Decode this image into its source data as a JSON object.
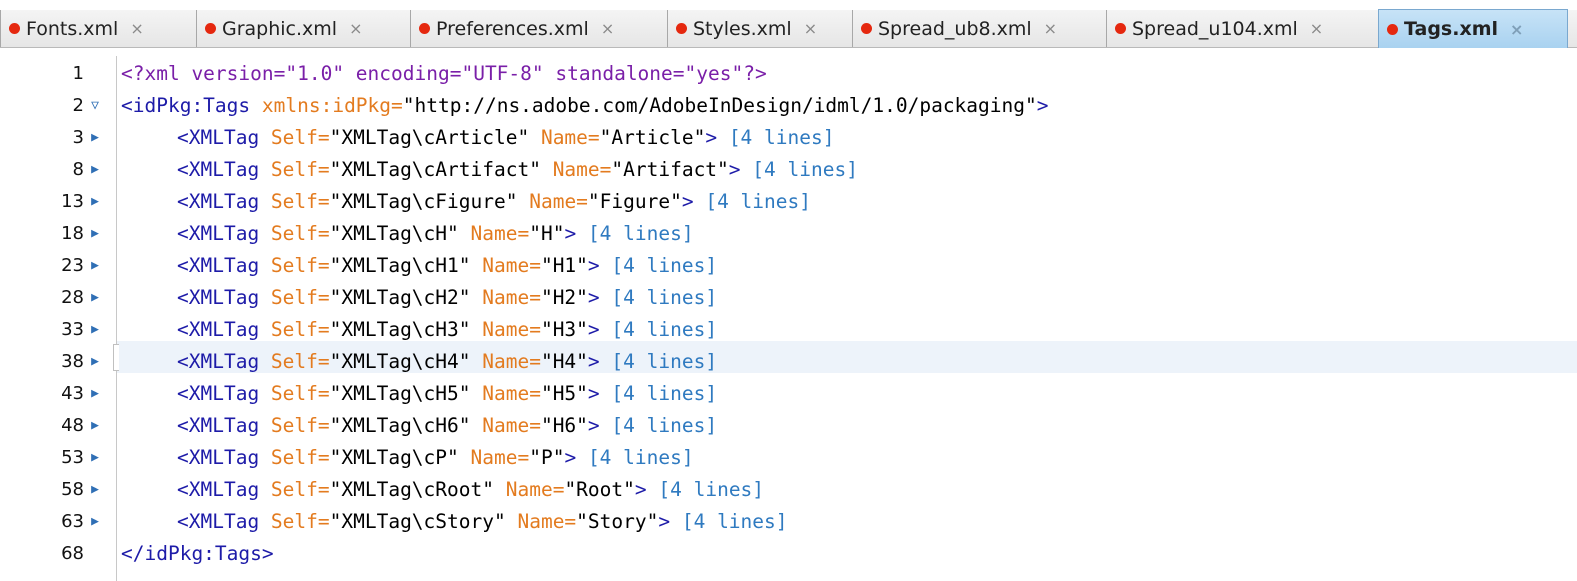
{
  "tabs": [
    {
      "label": "Fonts.xml",
      "close": "×",
      "active": false
    },
    {
      "label": "Graphic.xml",
      "close": "×",
      "active": false
    },
    {
      "label": "Preferences.xml",
      "close": "×",
      "active": false
    },
    {
      "label": "Styles.xml",
      "close": "×",
      "active": false
    },
    {
      "label": "Spread_ub8.xml",
      "close": "×",
      "active": false
    },
    {
      "label": "Spread_u104.xml",
      "close": "×",
      "active": false
    },
    {
      "label": "Tags.xml",
      "close": "×",
      "active": true
    }
  ],
  "editor": {
    "current_line": "38",
    "lines": [
      {
        "num": "1",
        "fold": "",
        "indent": false,
        "tokens": [
          {
            "c": "pi",
            "t": "<?xml version=\"1.0\" encoding=\"UTF-8\" standalone=\"yes\"?>"
          }
        ]
      },
      {
        "num": "2",
        "fold": "▽",
        "indent": false,
        "tokens": [
          {
            "c": "tag",
            "t": "<idPkg:Tags "
          },
          {
            "c": "attr",
            "t": "xmlns:idPkg="
          },
          {
            "c": "val",
            "t": "\"http://ns.adobe.com/AdobeInDesign/idml/1.0/packaging\""
          },
          {
            "c": "tag",
            "t": ">"
          }
        ]
      },
      {
        "num": "3",
        "fold": "▶",
        "indent": true,
        "tokens": [
          {
            "c": "tag",
            "t": "<XMLTag "
          },
          {
            "c": "attr",
            "t": "Self="
          },
          {
            "c": "val",
            "t": "\"XMLTag\\cArticle\" "
          },
          {
            "c": "attr",
            "t": "Name="
          },
          {
            "c": "val",
            "t": "\"Article\""
          },
          {
            "c": "tag",
            "t": "> "
          },
          {
            "c": "collapsed",
            "t": "[4 lines]"
          }
        ]
      },
      {
        "num": "8",
        "fold": "▶",
        "indent": true,
        "tokens": [
          {
            "c": "tag",
            "t": "<XMLTag "
          },
          {
            "c": "attr",
            "t": "Self="
          },
          {
            "c": "val",
            "t": "\"XMLTag\\cArtifact\" "
          },
          {
            "c": "attr",
            "t": "Name="
          },
          {
            "c": "val",
            "t": "\"Artifact\""
          },
          {
            "c": "tag",
            "t": "> "
          },
          {
            "c": "collapsed",
            "t": "[4 lines]"
          }
        ]
      },
      {
        "num": "13",
        "fold": "▶",
        "indent": true,
        "tokens": [
          {
            "c": "tag",
            "t": "<XMLTag "
          },
          {
            "c": "attr",
            "t": "Self="
          },
          {
            "c": "val",
            "t": "\"XMLTag\\cFigure\" "
          },
          {
            "c": "attr",
            "t": "Name="
          },
          {
            "c": "val",
            "t": "\"Figure\""
          },
          {
            "c": "tag",
            "t": "> "
          },
          {
            "c": "collapsed",
            "t": "[4 lines]"
          }
        ]
      },
      {
        "num": "18",
        "fold": "▶",
        "indent": true,
        "tokens": [
          {
            "c": "tag",
            "t": "<XMLTag "
          },
          {
            "c": "attr",
            "t": "Self="
          },
          {
            "c": "val",
            "t": "\"XMLTag\\cH\" "
          },
          {
            "c": "attr",
            "t": "Name="
          },
          {
            "c": "val",
            "t": "\"H\""
          },
          {
            "c": "tag",
            "t": "> "
          },
          {
            "c": "collapsed",
            "t": "[4 lines]"
          }
        ]
      },
      {
        "num": "23",
        "fold": "▶",
        "indent": true,
        "tokens": [
          {
            "c": "tag",
            "t": "<XMLTag "
          },
          {
            "c": "attr",
            "t": "Self="
          },
          {
            "c": "val",
            "t": "\"XMLTag\\cH1\" "
          },
          {
            "c": "attr",
            "t": "Name="
          },
          {
            "c": "val",
            "t": "\"H1\""
          },
          {
            "c": "tag",
            "t": "> "
          },
          {
            "c": "collapsed",
            "t": "[4 lines]"
          }
        ]
      },
      {
        "num": "28",
        "fold": "▶",
        "indent": true,
        "tokens": [
          {
            "c": "tag",
            "t": "<XMLTag "
          },
          {
            "c": "attr",
            "t": "Self="
          },
          {
            "c": "val",
            "t": "\"XMLTag\\cH2\" "
          },
          {
            "c": "attr",
            "t": "Name="
          },
          {
            "c": "val",
            "t": "\"H2\""
          },
          {
            "c": "tag",
            "t": "> "
          },
          {
            "c": "collapsed",
            "t": "[4 lines]"
          }
        ]
      },
      {
        "num": "33",
        "fold": "▶",
        "indent": true,
        "tokens": [
          {
            "c": "tag",
            "t": "<XMLTag "
          },
          {
            "c": "attr",
            "t": "Self="
          },
          {
            "c": "val",
            "t": "\"XMLTag\\cH3\" "
          },
          {
            "c": "attr",
            "t": "Name="
          },
          {
            "c": "val",
            "t": "\"H3\""
          },
          {
            "c": "tag",
            "t": "> "
          },
          {
            "c": "collapsed",
            "t": "[4 lines]"
          }
        ]
      },
      {
        "num": "38",
        "fold": "▶",
        "indent": true,
        "tokens": [
          {
            "c": "tag",
            "t": "<XMLTag "
          },
          {
            "c": "attr",
            "t": "Self="
          },
          {
            "c": "val",
            "t": "\"XMLTag\\cH4\" "
          },
          {
            "c": "attr",
            "t": "Name="
          },
          {
            "c": "val",
            "t": "\"H4\""
          },
          {
            "c": "tag",
            "t": "> "
          },
          {
            "c": "collapsed",
            "t": "[4 lines]"
          }
        ]
      },
      {
        "num": "43",
        "fold": "▶",
        "indent": true,
        "tokens": [
          {
            "c": "tag",
            "t": "<XMLTag "
          },
          {
            "c": "attr",
            "t": "Self="
          },
          {
            "c": "val",
            "t": "\"XMLTag\\cH5\" "
          },
          {
            "c": "attr",
            "t": "Name="
          },
          {
            "c": "val",
            "t": "\"H5\""
          },
          {
            "c": "tag",
            "t": "> "
          },
          {
            "c": "collapsed",
            "t": "[4 lines]"
          }
        ]
      },
      {
        "num": "48",
        "fold": "▶",
        "indent": true,
        "tokens": [
          {
            "c": "tag",
            "t": "<XMLTag "
          },
          {
            "c": "attr",
            "t": "Self="
          },
          {
            "c": "val",
            "t": "\"XMLTag\\cH6\" "
          },
          {
            "c": "attr",
            "t": "Name="
          },
          {
            "c": "val",
            "t": "\"H6\""
          },
          {
            "c": "tag",
            "t": "> "
          },
          {
            "c": "collapsed",
            "t": "[4 lines]"
          }
        ]
      },
      {
        "num": "53",
        "fold": "▶",
        "indent": true,
        "tokens": [
          {
            "c": "tag",
            "t": "<XMLTag "
          },
          {
            "c": "attr",
            "t": "Self="
          },
          {
            "c": "val",
            "t": "\"XMLTag\\cP\" "
          },
          {
            "c": "attr",
            "t": "Name="
          },
          {
            "c": "val",
            "t": "\"P\""
          },
          {
            "c": "tag",
            "t": "> "
          },
          {
            "c": "collapsed",
            "t": "[4 lines]"
          }
        ]
      },
      {
        "num": "58",
        "fold": "▶",
        "indent": true,
        "tokens": [
          {
            "c": "tag",
            "t": "<XMLTag "
          },
          {
            "c": "attr",
            "t": "Self="
          },
          {
            "c": "val",
            "t": "\"XMLTag\\cRoot\" "
          },
          {
            "c": "attr",
            "t": "Name="
          },
          {
            "c": "val",
            "t": "\"Root\""
          },
          {
            "c": "tag",
            "t": "> "
          },
          {
            "c": "collapsed",
            "t": "[4 lines]"
          }
        ]
      },
      {
        "num": "63",
        "fold": "▶",
        "indent": true,
        "tokens": [
          {
            "c": "tag",
            "t": "<XMLTag "
          },
          {
            "c": "attr",
            "t": "Self="
          },
          {
            "c": "val",
            "t": "\"XMLTag\\cStory\" "
          },
          {
            "c": "attr",
            "t": "Name="
          },
          {
            "c": "val",
            "t": "\"Story\""
          },
          {
            "c": "tag",
            "t": "> "
          },
          {
            "c": "collapsed",
            "t": "[4 lines]"
          }
        ]
      },
      {
        "num": "68",
        "fold": "",
        "indent": false,
        "tokens": [
          {
            "c": "tag",
            "t": "</idPkg:Tags>"
          }
        ]
      }
    ]
  },
  "colors": {
    "tag": "#1d1ba8",
    "attribute": "#e37b1f",
    "value": "#000000",
    "processing_instruction": "#7a1fa8",
    "collapsed_marker": "#2f7ac0",
    "tab_dot": "#e5280f",
    "active_tab": "#b7daf3",
    "current_line": "#edf3fa"
  }
}
